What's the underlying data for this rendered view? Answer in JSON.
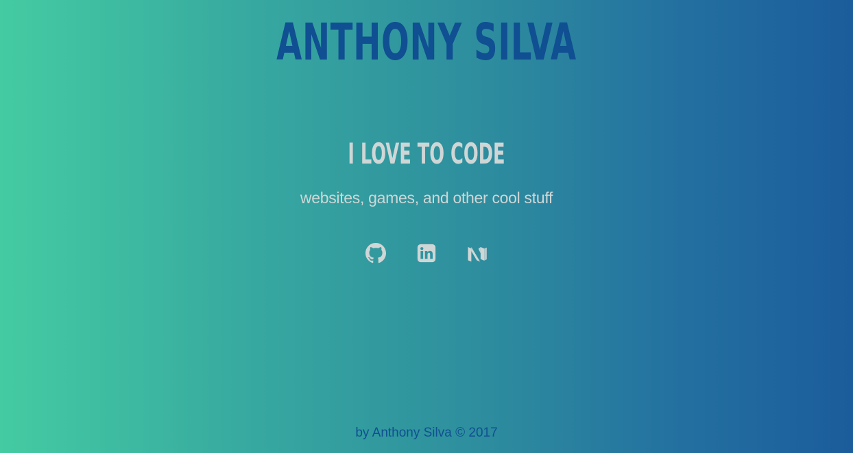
{
  "header": {
    "title": "ANTHONY SILVA"
  },
  "hero": {
    "tagline": "I LOVE TO CODE",
    "subtitle": "websites, games, and other cool stuff"
  },
  "social_links": [
    {
      "icon": "github-icon"
    },
    {
      "icon": "linkedin-icon"
    },
    {
      "icon": "medium-icon"
    }
  ],
  "footer": {
    "text": "by Anthony Silva © 2017"
  },
  "colors": {
    "gradient_start": "#44cba2",
    "gradient_end": "#1b5c9c",
    "title": "#0f4f92",
    "text_light": "#cfd6d6"
  }
}
